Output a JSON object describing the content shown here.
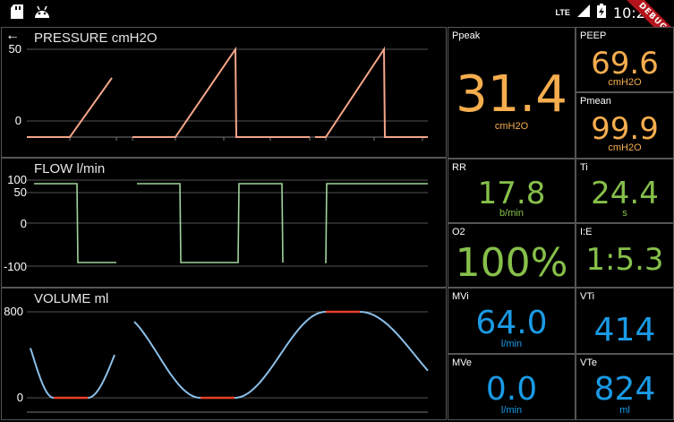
{
  "statusbar": {
    "network": "LTE",
    "time": "10:21",
    "debug_banner": "DEBUG",
    "icons": [
      "sd-card-icon",
      "android-icon",
      "signal-icon",
      "battery-charging-icon"
    ]
  },
  "colors": {
    "pressure": "#f4a58a",
    "flow": "#9fd49a",
    "volume": "#8cbfe8",
    "highlight": "#e8402a",
    "metric_orange": "#f5ad4e",
    "metric_green": "#86c04a",
    "metric_blue": "#1a9be6"
  },
  "charts": {
    "pressure": {
      "title": "PRESSURE cmH2O",
      "ticks": [
        "50",
        "0"
      ],
      "tick_values": [
        50,
        0
      ]
    },
    "flow": {
      "title": "FLOW l/min",
      "ticks": [
        "100",
        "50",
        "0",
        "-100"
      ],
      "tick_values": [
        100,
        50,
        0,
        -100
      ]
    },
    "volume": {
      "title": "VOLUME ml",
      "ticks": [
        "800",
        "0"
      ],
      "tick_values": [
        800,
        0
      ]
    }
  },
  "metrics": {
    "ppeak": {
      "label": "Ppeak",
      "value": "31.4",
      "unit": "cmH2O"
    },
    "peep": {
      "label": "PEEP",
      "value": "69.6",
      "unit": "cmH2O"
    },
    "pmean": {
      "label": "Pmean",
      "value": "99.9",
      "unit": "cmH2O"
    },
    "rr": {
      "label": "RR",
      "value": "17.8",
      "unit": "b/min"
    },
    "ti": {
      "label": "Ti",
      "value": "24.4",
      "unit": "s"
    },
    "o2": {
      "label": "O2",
      "value": "100%"
    },
    "ie": {
      "label": "I:E",
      "value": "1:5.3"
    },
    "mvi": {
      "label": "MVi",
      "value": "64.0",
      "unit": "l/min"
    },
    "vti": {
      "label": "VTi",
      "value": "414"
    },
    "mve": {
      "label": "MVe",
      "value": "0.0",
      "unit": "l/min"
    },
    "vte": {
      "label": "VTe",
      "value": "824",
      "unit": "ml"
    }
  }
}
